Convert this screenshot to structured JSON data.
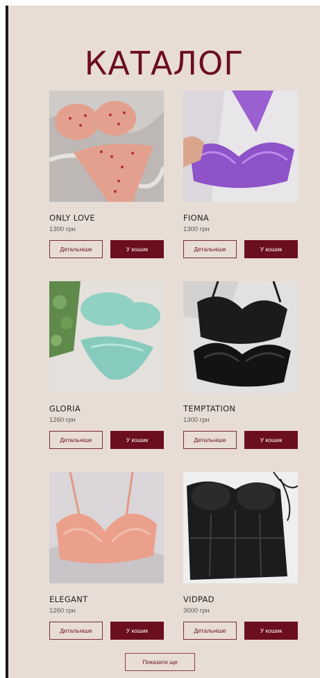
{
  "page": {
    "title": "КАТАЛОГ"
  },
  "buttons": {
    "details": "Детальніше",
    "cart": "У кошик",
    "load_more": "Показати ще"
  },
  "products": [
    {
      "name": "ONLY LOVE",
      "price": "1300 грн",
      "image": "pink-polka-dot-lingerie-image"
    },
    {
      "name": "FIONA",
      "price": "1300 грн",
      "image": "purple-lace-lingerie-image"
    },
    {
      "name": "GLORIA",
      "price": "1260 грн",
      "image": "mint-lace-lingerie-image"
    },
    {
      "name": "TEMPTATION",
      "price": "1300 грн",
      "image": "black-lace-bra-image"
    },
    {
      "name": "ELEGANT",
      "price": "1260 грн",
      "image": "peach-lace-bra-image"
    },
    {
      "name": "VIDPAD",
      "price": "3000 грн",
      "image": "black-corset-image"
    }
  ]
}
